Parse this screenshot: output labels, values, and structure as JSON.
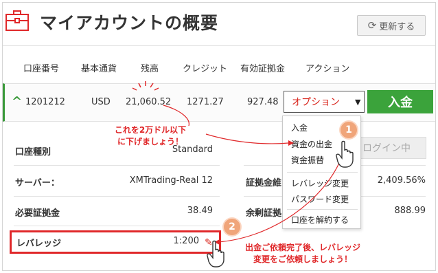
{
  "header": {
    "title": "マイアカウントの概要",
    "refresh_label": "更新する"
  },
  "table": {
    "columns": [
      "口座番号",
      "基本通貨",
      "残高",
      "クレジット",
      "有効証拠金",
      "アクション"
    ]
  },
  "account": {
    "number": "1201212",
    "currency": "USD",
    "balance": "21,060.52",
    "credit": "1271.27",
    "equity": "927.48",
    "options_label": "オプション",
    "deposit_label": "入金",
    "login_label": "ログイン中"
  },
  "details": {
    "account_type_label": "口座種別",
    "account_type_value": "Standard",
    "server_label": "サーバー：",
    "server_value": "XMTrading-Real 12",
    "margin_level_label": "証拠金維",
    "margin_level_value": "2,409.56%",
    "required_margin_label": "必要証拠金",
    "required_margin_value": "38.49",
    "free_margin_label": "余剰証拠",
    "free_margin_value": "888.99",
    "leverage_label": "レバレッジ",
    "leverage_value": "1:200"
  },
  "dropdown": {
    "items": [
      "入金",
      "資金の出金",
      "資金振替",
      "レバレッジ変更",
      "パスワード変更",
      "口座を解約する"
    ]
  },
  "annotations": {
    "note1_line1": "これを2万ドル以下",
    "note1_line2": "に下げましょう！",
    "note2_line1": "出金ご依頼完了後、レバレッジ",
    "note2_line2": "変更をご依頼しましょう！",
    "badge1": "1",
    "badge2": "2",
    "color": "#e0282a"
  }
}
